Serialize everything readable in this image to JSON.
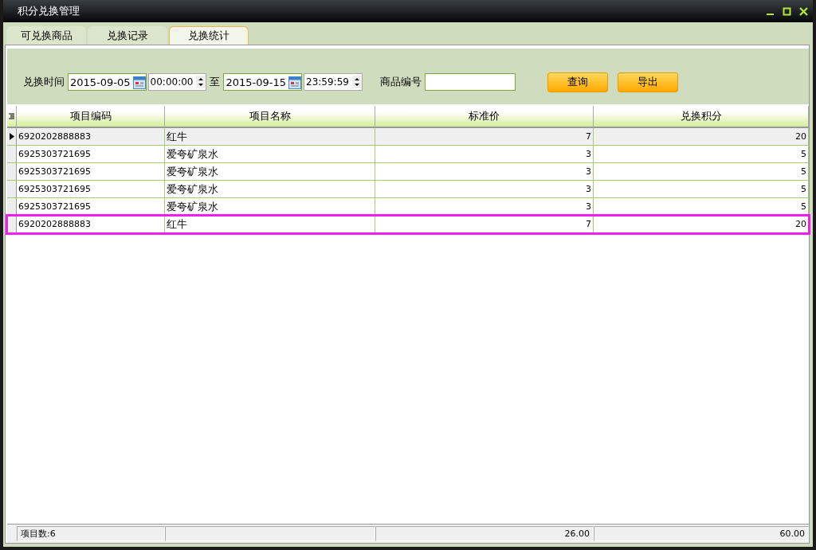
{
  "window": {
    "title": "积分兑换管理"
  },
  "tabs": [
    {
      "label": "可兑换商品",
      "selected": false
    },
    {
      "label": "兑换记录",
      "selected": false
    },
    {
      "label": "兑换统计",
      "selected": true
    }
  ],
  "filters": {
    "time_label": "兑换时间",
    "start_date": "2015-09-05",
    "start_time": "00:00:00",
    "to_label": "至",
    "end_date": "2015-09-15",
    "end_time": "23:59:59",
    "code_label": "商品编号",
    "query_button": "查询",
    "export_button": "导出"
  },
  "table": {
    "columns": [
      "项目编码",
      "项目名称",
      "标准价",
      "兑换积分"
    ],
    "rows": [
      {
        "cells": [
          "6920202888883",
          "红牛",
          "7",
          "20"
        ],
        "current": true,
        "highlighted": false
      },
      {
        "cells": [
          "6925303721695",
          "爱夸矿泉水",
          "3",
          "5"
        ],
        "current": false,
        "highlighted": false
      },
      {
        "cells": [
          "6925303721695",
          "爱夸矿泉水",
          "3",
          "5"
        ],
        "current": false,
        "highlighted": false
      },
      {
        "cells": [
          "6925303721695",
          "爱夸矿泉水",
          "3",
          "5"
        ],
        "current": false,
        "highlighted": false
      },
      {
        "cells": [
          "6925303721695",
          "爱夸矿泉水",
          "3",
          "5"
        ],
        "current": false,
        "highlighted": false
      },
      {
        "cells": [
          "6920202888883",
          "红牛",
          "7",
          "20"
        ],
        "current": false,
        "highlighted": true
      }
    ],
    "footer": {
      "count": "项目数:6",
      "price_total": "26.00",
      "points_total": "60.00"
    }
  }
}
